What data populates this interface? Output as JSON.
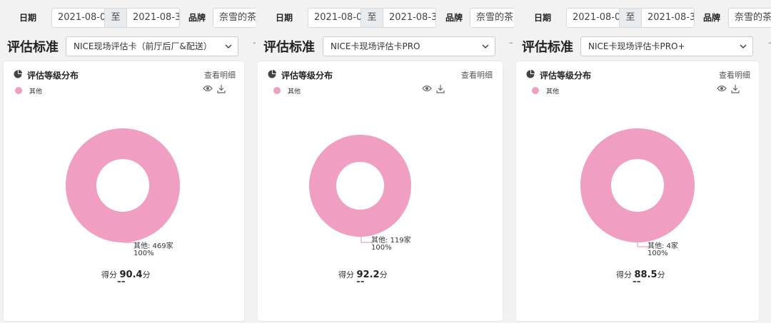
{
  "colors": {
    "slice": "#f09fc2",
    "card_bg": "#ffffff",
    "page_bg": "#f2f2f2"
  },
  "panels": [
    {
      "filters": {
        "date_label": "日期",
        "date_from": "2021-08-0",
        "date_sep": "至",
        "date_to": "2021-08-3",
        "brand_label": "品牌",
        "brand_value": "奈雪的茶"
      },
      "criteria": {
        "label": "评估标准",
        "selected": "NICE现场评估卡（前厅后厂&配送）"
      },
      "card": {
        "title": "评估等级分布",
        "detail_link": "查看明细",
        "legend": "其他",
        "slice_label_line1": "其他: 469家",
        "slice_label_line2": "100%",
        "score_prefix": "得分",
        "score_value": "90.4",
        "score_unit": "分",
        "score_sub": "--"
      },
      "chart_data": {
        "type": "pie",
        "categories": [
          "其他"
        ],
        "values": [
          469
        ],
        "percent": [
          100
        ],
        "unit": "家"
      }
    },
    {
      "filters": {
        "date_label": "日期",
        "date_from": "2021-08-0",
        "date_sep": "至",
        "date_to": "2021-08-3",
        "brand_label": "品牌",
        "brand_value": "奈雪的茶"
      },
      "criteria": {
        "label": "评估标准",
        "selected": "NICE卡现场评估卡PRO"
      },
      "card": {
        "title": "评估等级分布",
        "detail_link": "查看明细",
        "legend": "其他",
        "slice_label_line1": "其他: 119家",
        "slice_label_line2": "100%",
        "score_prefix": "得分",
        "score_value": "92.2",
        "score_unit": "分",
        "score_sub": "--"
      },
      "chart_data": {
        "type": "pie",
        "categories": [
          "其他"
        ],
        "values": [
          119
        ],
        "percent": [
          100
        ],
        "unit": "家"
      }
    },
    {
      "filters": {
        "date_label": "日期",
        "date_from": "2021-08-0",
        "date_sep": "至",
        "date_to": "2021-08-3",
        "brand_label": "品牌",
        "brand_value": "奈雪的茶"
      },
      "criteria": {
        "label": "评估标准",
        "selected": "NICE卡现场评估卡PRO+"
      },
      "card": {
        "title": "评估等级分布",
        "detail_link": "查看明细",
        "legend": "其他",
        "slice_label_line1": "其他: 4家",
        "slice_label_line2": "100%",
        "score_prefix": "得分",
        "score_value": "88.5",
        "score_unit": "分",
        "score_sub": "--"
      },
      "chart_data": {
        "type": "pie",
        "categories": [
          "其他"
        ],
        "values": [
          4
        ],
        "percent": [
          100
        ],
        "unit": "家"
      }
    }
  ]
}
